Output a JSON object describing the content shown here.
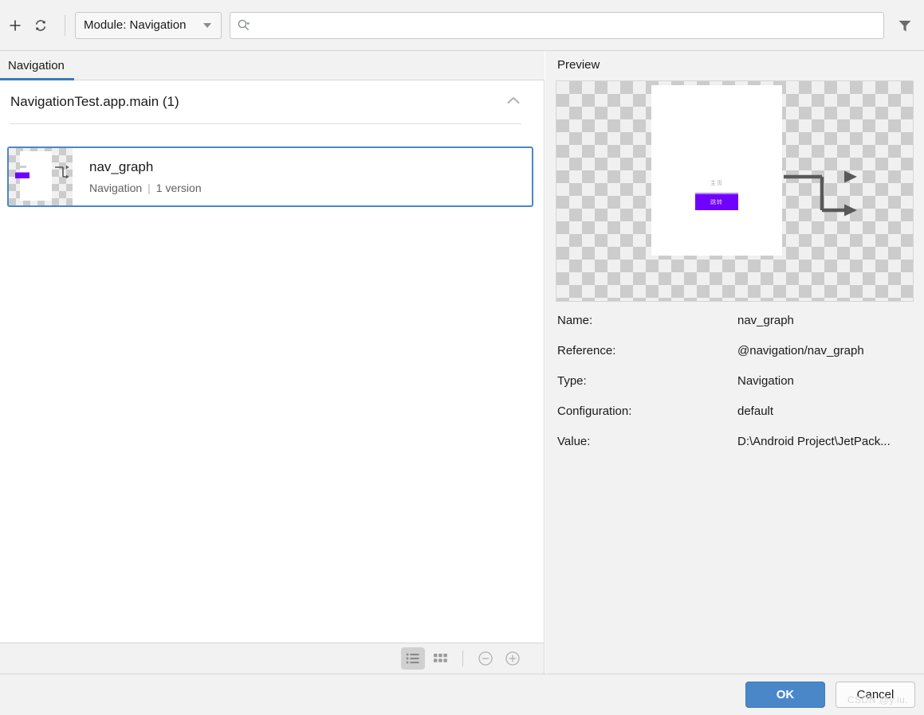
{
  "toolbar": {
    "add_label": "+",
    "refresh_label": "refresh",
    "module_selector_value": "Module: Navigation",
    "search_value": "",
    "search_placeholder": "",
    "filter_label": "filter"
  },
  "tabs": [
    {
      "label": "Navigation",
      "active": true
    }
  ],
  "list": {
    "group": {
      "title": "NavigationTest.app.main (1)",
      "collapsed": false
    },
    "items": [
      {
        "name": "nav_graph",
        "type": "Navigation",
        "separator": "|",
        "versions": "1 version",
        "selected": true
      }
    ]
  },
  "view_toolbar": {
    "list_view_label": "list-view",
    "grid_view_label": "grid-view",
    "zoom_out_label": "zoom-out",
    "zoom_in_label": "zoom-in",
    "selected_view": "list"
  },
  "preview": {
    "label": "Preview",
    "canvas": {
      "text_label": "主页",
      "button_label": "跳转"
    },
    "details": [
      {
        "key": "Name:",
        "value": "nav_graph"
      },
      {
        "key": "Reference:",
        "value": "@navigation/nav_graph"
      },
      {
        "key": "Type:",
        "value": "Navigation"
      },
      {
        "key": "Configuration:",
        "value": "default"
      },
      {
        "key": "Value:",
        "value": "D:\\Android Project\\JetPack..."
      }
    ]
  },
  "footer": {
    "ok_label": "OK",
    "cancel_label": "Cancel"
  },
  "watermark": {
    "text": "CSDN @y.iu."
  },
  "colors": {
    "accent": "#4a87c9",
    "tab_underline": "#3d7ab8",
    "panel_bg": "#f2f2f2",
    "purple_button": "#7000ff",
    "checker_dark": "#cccccc",
    "checker_light": "#f0f0f0"
  }
}
